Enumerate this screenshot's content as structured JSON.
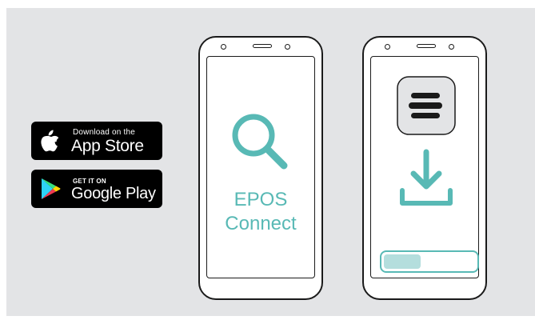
{
  "stores": {
    "apple": {
      "small_label": "Download on the",
      "big_label": "App Store",
      "icon": "apple-icon"
    },
    "google": {
      "small_label": "GET IT ON",
      "big_label": "Google Play",
      "icon": "google-play-icon"
    }
  },
  "phone_search": {
    "app_name_line1": "EPOS",
    "app_name_line2": "Connect",
    "icon": "search-icon"
  },
  "phone_install": {
    "app_icon": "epos-logo-icon",
    "download_icon": "download-icon",
    "progress": 0.4
  },
  "colors": {
    "accent": "#58b9b5",
    "progress_fill": "#b4dedd",
    "background_panel": "#e3e4e6"
  }
}
